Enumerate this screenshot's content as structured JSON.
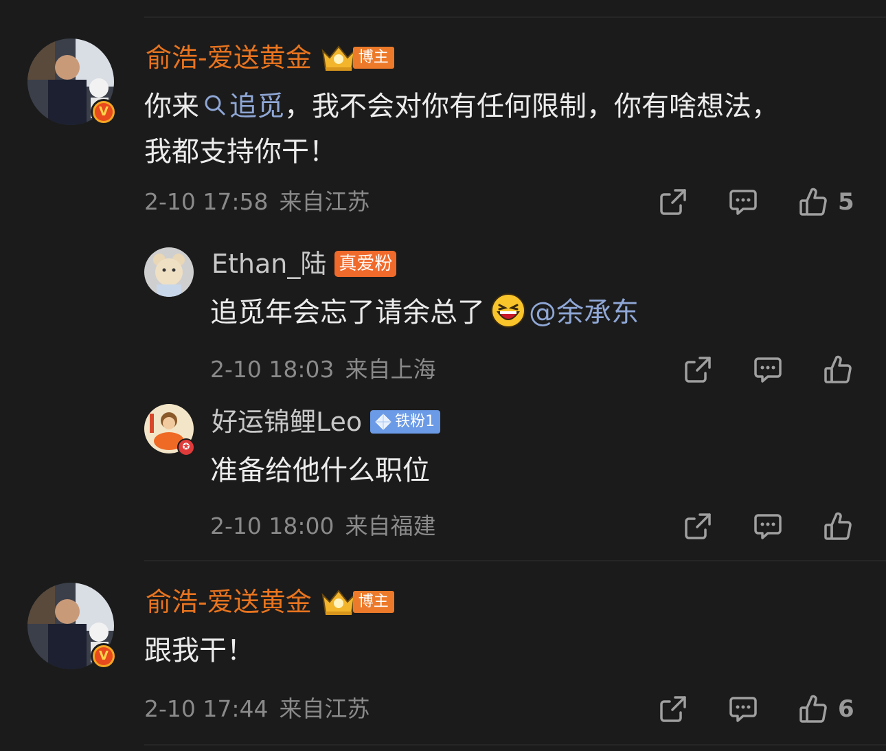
{
  "comments": [
    {
      "name": "俞浩-爱送黄金",
      "badge": "博主",
      "text_a": "你来",
      "link": "追觅",
      "text_b": "，我不会对你有任何限制，你有啥想法，",
      "text_c": "我都支持你干！",
      "date": "2-10 17:58",
      "location": "来自江苏",
      "likes": "5"
    },
    {
      "name": "Ethan_陆",
      "badge": "真爱粉",
      "text": "追觅年会忘了请余总了",
      "mention": "@余承东",
      "date": "2-10 18:03",
      "location": "来自上海"
    },
    {
      "name": "好运锦鲤Leo",
      "badge": "铁粉1",
      "text": "准备给他什么职位",
      "date": "2-10 18:00",
      "location": "来自福建"
    },
    {
      "name": "俞浩-爱送黄金",
      "badge": "博主",
      "text": "跟我干！",
      "date": "2-10 17:44",
      "location": "来自江苏",
      "likes": "6"
    }
  ],
  "colors": {
    "background": "#1b1b1b",
    "author_name": "#e8741f",
    "link": "#8fa7d6",
    "meta": "#8a8a8a"
  }
}
